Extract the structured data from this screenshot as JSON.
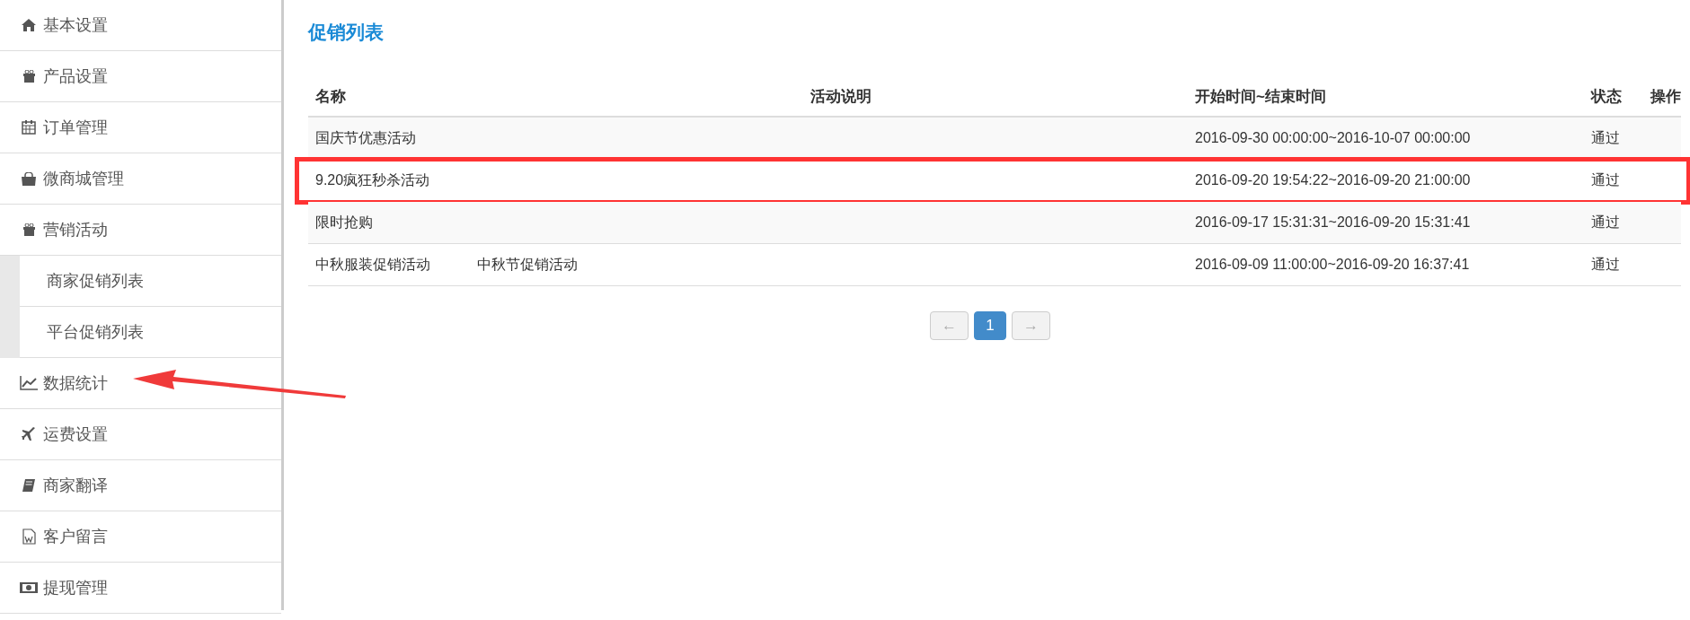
{
  "sidebar": {
    "items": [
      {
        "label": "基本设置"
      },
      {
        "label": "产品设置"
      },
      {
        "label": "订单管理"
      },
      {
        "label": "微商城管理"
      },
      {
        "label": "营销活动",
        "expanded": true,
        "children": [
          {
            "label": "商家促销列表"
          },
          {
            "label": "平台促销列表"
          }
        ]
      },
      {
        "label": "数据统计",
        "pointed_at": true
      },
      {
        "label": "运费设置"
      },
      {
        "label": "商家翻译"
      },
      {
        "label": "客户留言"
      },
      {
        "label": "提现管理"
      }
    ]
  },
  "page_title": "促销列表",
  "table": {
    "columns": [
      "名称",
      "活动说明",
      "开始时间~结束时间",
      "状态",
      "操作"
    ],
    "rows": [
      {
        "name": "国庆节优惠活动",
        "period": "2016-09-30 00:00:00~2016-10-07 00:00:00",
        "status": "通过",
        "highlighted": false
      },
      {
        "name": "9.20疯狂秒杀活动",
        "period": "2016-09-20 19:54:22~2016-09-20 21:00:00",
        "status": "通过",
        "highlighted": true
      },
      {
        "name": "限时抢购",
        "period": "2016-09-17 15:31:31~2016-09-20 15:31:41",
        "status": "通过",
        "highlighted": false
      },
      {
        "name": "中秋服装促销活动",
        "name_note": "中秋节促销活动",
        "period": "2016-09-09 11:00:00~2016-09-20 16:37:41",
        "status": "通过",
        "highlighted": false
      }
    ]
  },
  "pagination": {
    "prev": "←",
    "pages": [
      {
        "label": "1",
        "selected": true
      }
    ],
    "next": "→"
  }
}
